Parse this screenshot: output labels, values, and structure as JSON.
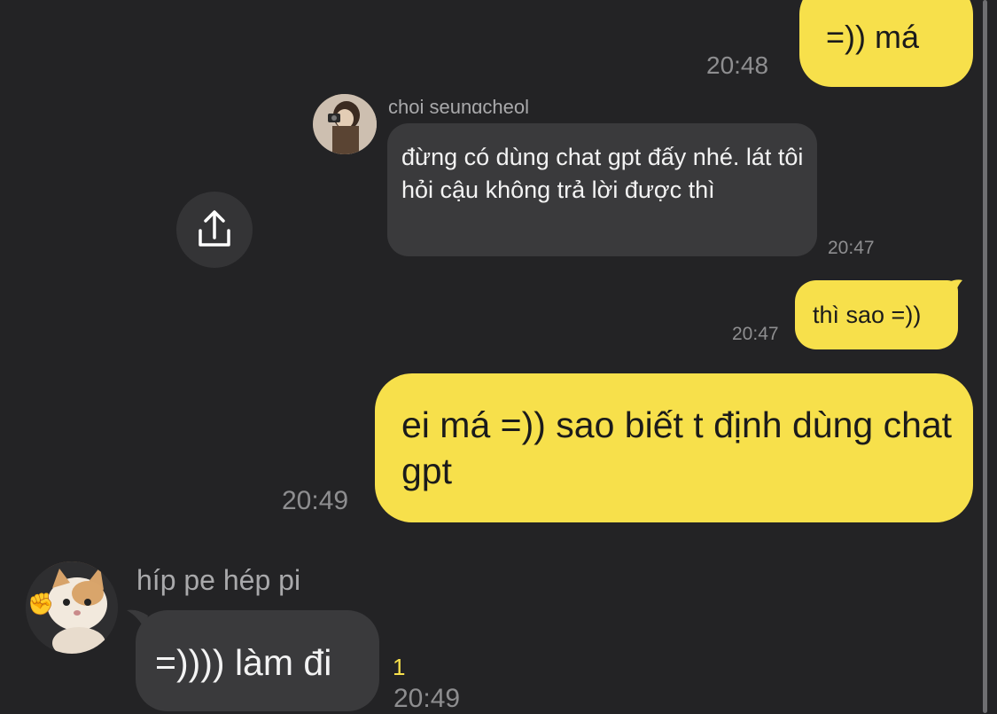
{
  "messages": [
    {
      "id": "m1",
      "direction": "outgoing",
      "text": "=)) má",
      "time": "20:48"
    },
    {
      "id": "m2",
      "direction": "incoming",
      "sender": "choi seungcheol",
      "text": "đừng có dùng chat gpt đấy nhé. lát tôi hỏi cậu không trả lời được thì",
      "time": "20:47"
    },
    {
      "id": "m3",
      "direction": "outgoing",
      "text": "thì sao =))",
      "time": "20:47"
    },
    {
      "id": "m4",
      "direction": "outgoing",
      "text": "ei má =)) sao biết t định dùng chat gpt",
      "time": "20:49"
    },
    {
      "id": "m5",
      "direction": "incoming",
      "sender": "híp pe hép pi",
      "text": "=)))) làm đi",
      "time": "20:49",
      "unread_count": "1"
    }
  ],
  "icons": {
    "share": "share-icon",
    "avatar_1": "avatar",
    "avatar_2": "avatar"
  },
  "colors": {
    "background": "#232325",
    "outgoing_bubble": "#f7e04b",
    "incoming_bubble": "#3a3a3c",
    "timestamp": "#8e8e90",
    "unread": "#f7e04b"
  }
}
